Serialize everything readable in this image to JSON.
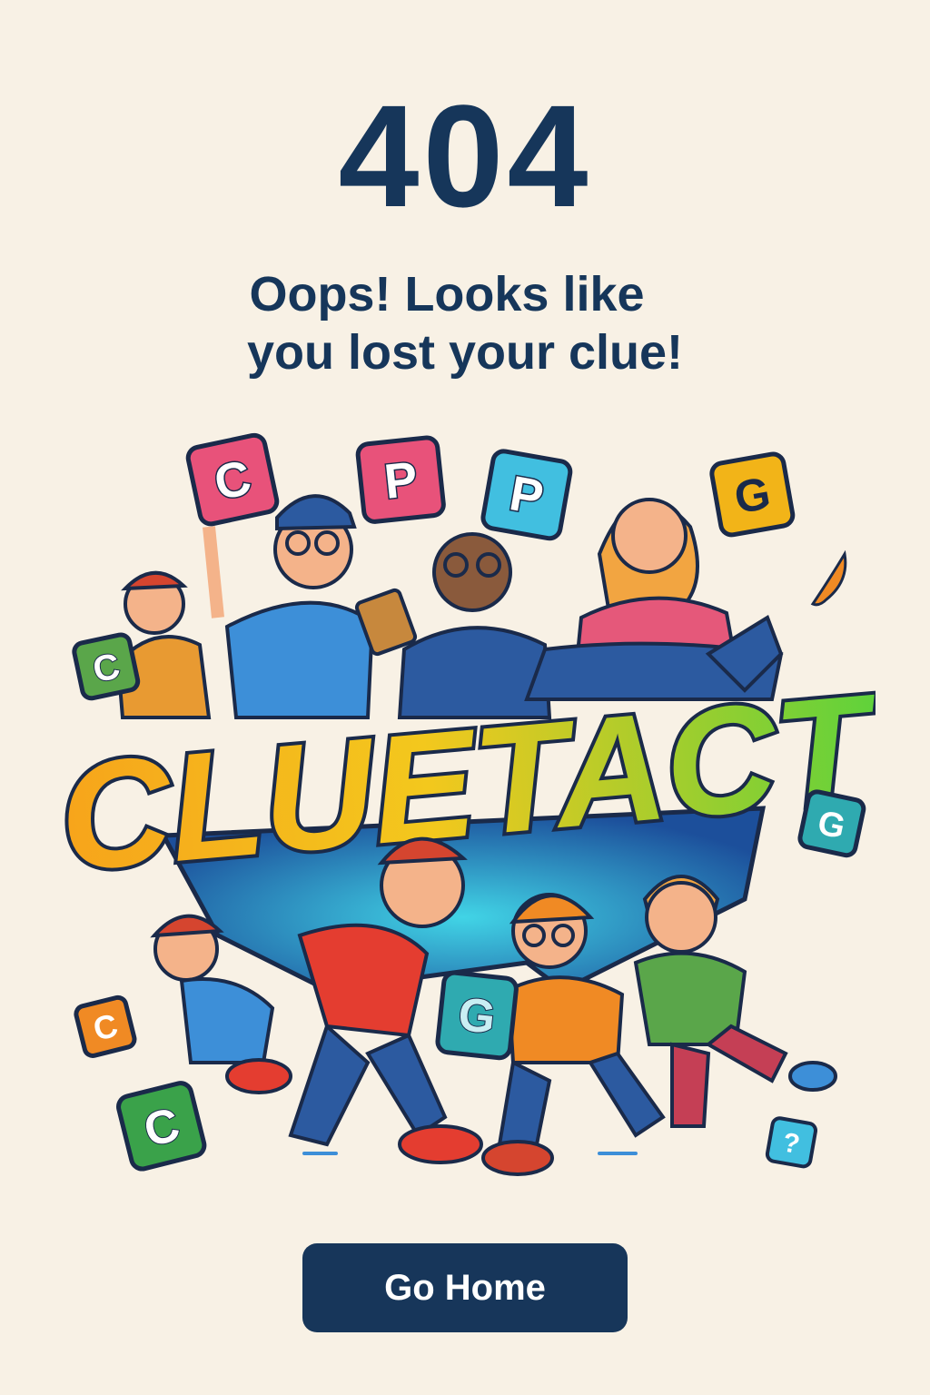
{
  "error": {
    "code": "404",
    "message_line1": "Oops! Looks like",
    "message_line2": "you lost your clue!"
  },
  "illustration": {
    "logo_text": "CLUETACT",
    "tiles": [
      "C",
      "P",
      "P",
      "G",
      "C",
      "G",
      "G",
      "C",
      "C",
      "?"
    ]
  },
  "actions": {
    "home_label": "Go Home"
  },
  "colors": {
    "background": "#f8f1e5",
    "text": "#16365a",
    "button": "#17365a",
    "logo_orange": "#f7a41b",
    "logo_green": "#5fd23b"
  }
}
